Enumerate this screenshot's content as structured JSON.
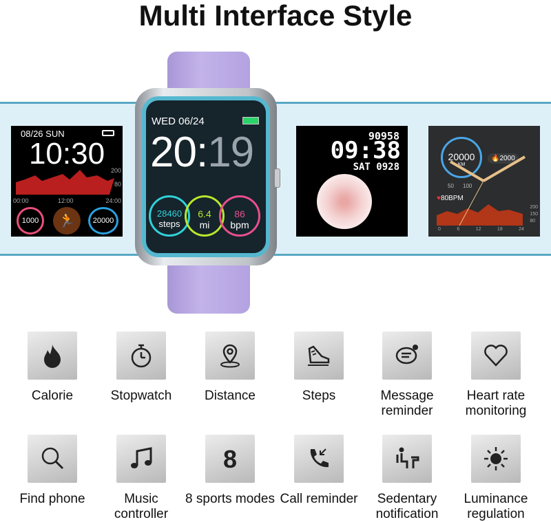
{
  "title": "Multi Interface Style",
  "watch_main": {
    "date": "WED  06/24",
    "time_h": "20:",
    "time_m": "19",
    "steps": "28460",
    "steps_unit": "steps",
    "distance": "6.4",
    "distance_unit": "mi",
    "heart": "86",
    "heart_unit": "bpm",
    "strap_color": "#b9a6e0"
  },
  "face1": {
    "date": "08/26  SUN",
    "time": "10:30",
    "y_hi": "200",
    "y_lo": "80",
    "x0": "00:00",
    "x1": "12:00",
    "x2": "24:00",
    "left_val": "1000",
    "right_val": "20000"
  },
  "face2": {
    "steps": "90958",
    "time": "09:38",
    "date": "SAT  0928"
  },
  "face3": {
    "steps": "20000",
    "cal": "2000",
    "km": "KM",
    "scale": [
      "50",
      "100"
    ],
    "bpm": "80BPM",
    "y_ticks": [
      "200",
      "150",
      "80"
    ],
    "x_ticks": [
      "0",
      "6",
      "12",
      "18",
      "24"
    ]
  },
  "features": [
    {
      "label": "Calorie",
      "icon": "flame-icon"
    },
    {
      "label": "Stopwatch",
      "icon": "stopwatch-icon"
    },
    {
      "label": "Distance",
      "icon": "location-pin-icon"
    },
    {
      "label": "Steps",
      "icon": "shoe-icon"
    },
    {
      "label": "Message reminder",
      "icon": "message-icon"
    },
    {
      "label": "Heart rate monitoring",
      "icon": "heart-icon"
    },
    {
      "label": "Find phone",
      "icon": "magnifier-icon"
    },
    {
      "label": "Music controller",
      "icon": "music-note-icon"
    },
    {
      "label": "8 sports modes",
      "icon": "number-8-icon"
    },
    {
      "label": "Call reminder",
      "icon": "phone-call-icon"
    },
    {
      "label": "Sedentary notification",
      "icon": "sedentary-icon"
    },
    {
      "label": "Luminance regulation",
      "icon": "sun-icon"
    }
  ]
}
